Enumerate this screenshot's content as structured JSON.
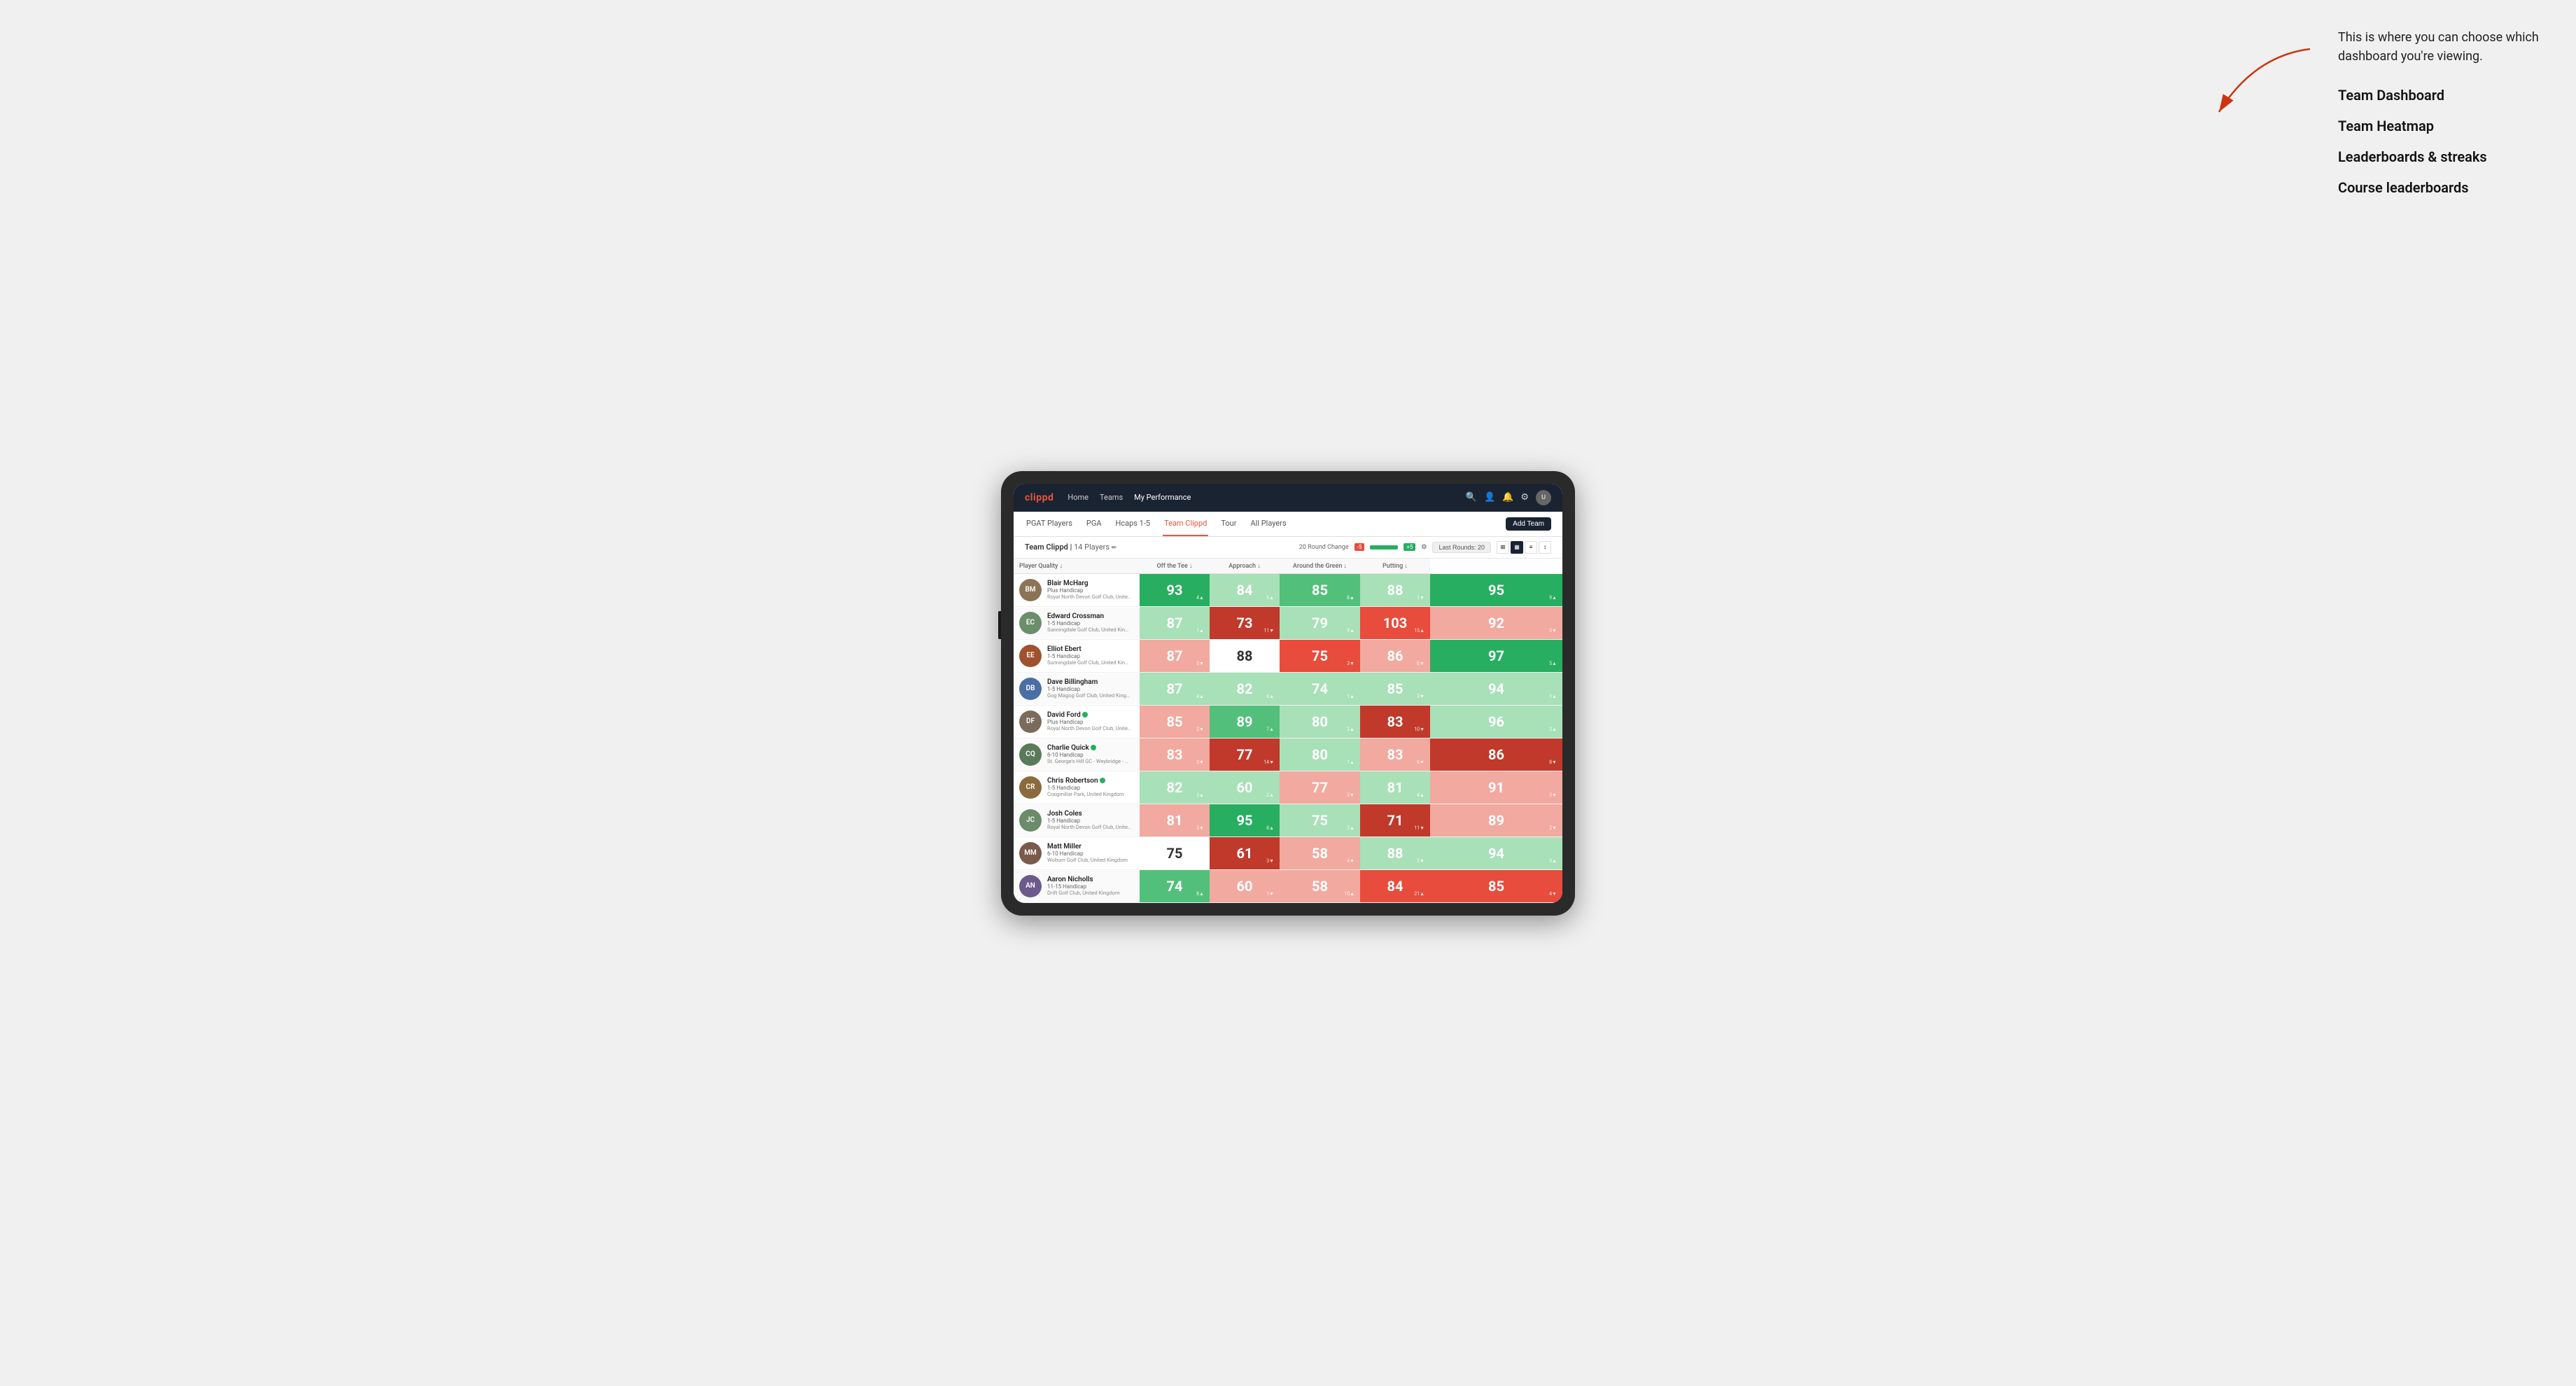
{
  "annotation": {
    "intro_text": "This is where you can choose which dashboard you're viewing.",
    "items": [
      "Team Dashboard",
      "Team Heatmap",
      "Leaderboards & streaks",
      "Course leaderboards"
    ]
  },
  "nav": {
    "logo": "clippd",
    "items": [
      {
        "label": "Home",
        "active": false
      },
      {
        "label": "Teams",
        "active": false
      },
      {
        "label": "My Performance",
        "active": true
      }
    ],
    "icons": [
      "search",
      "person",
      "bell",
      "settings",
      "user-avatar"
    ]
  },
  "sub_nav": {
    "tabs": [
      {
        "label": "PGAT Players",
        "active": false
      },
      {
        "label": "PGA",
        "active": false
      },
      {
        "label": "Hcaps 1-5",
        "active": false
      },
      {
        "label": "Team Clippd",
        "active": true
      },
      {
        "label": "Tour",
        "active": false
      },
      {
        "label": "All Players",
        "active": false
      }
    ],
    "add_team_label": "Add Team"
  },
  "team_header": {
    "title": "Team Clippd",
    "player_count": "14 Players",
    "round_change_label": "20 Round Change",
    "neg_value": "-5",
    "pos_value": "+5",
    "last_rounds_label": "Last Rounds:",
    "last_rounds_value": "20",
    "view_types": [
      "grid-small",
      "grid-large",
      "heatmap",
      "settings"
    ]
  },
  "columns": [
    {
      "label": "Player Quality",
      "key": "player_quality",
      "has_arrow": true
    },
    {
      "label": "Off the Tee",
      "key": "off_tee",
      "has_arrow": true
    },
    {
      "label": "Approach",
      "key": "approach",
      "has_arrow": true
    },
    {
      "label": "Around the Green",
      "key": "around_green",
      "has_arrow": true
    },
    {
      "label": "Putting",
      "key": "putting",
      "has_arrow": true
    }
  ],
  "players": [
    {
      "name": "Blair McHarg",
      "handicap": "Plus Handicap",
      "club": "Royal North Devon Golf Club, United Kingdom",
      "avatar_color": "#8B7355",
      "initials": "BM",
      "verified": false,
      "scores": [
        {
          "value": "93",
          "change": "4▲",
          "change_dir": "up",
          "bg": "bg-green-dark"
        },
        {
          "value": "84",
          "change": "6▲",
          "change_dir": "up",
          "bg": "bg-green-light"
        },
        {
          "value": "85",
          "change": "8▲",
          "change_dir": "up",
          "bg": "bg-green-mid"
        },
        {
          "value": "88",
          "change": "1▼",
          "change_dir": "down",
          "bg": "bg-green-light"
        },
        {
          "value": "95",
          "change": "9▲",
          "change_dir": "up",
          "bg": "bg-green-dark"
        }
      ]
    },
    {
      "name": "Edward Crossman",
      "handicap": "1-5 Handicap",
      "club": "Sunningdale Golf Club, United Kingdom",
      "avatar_color": "#6B8E6B",
      "initials": "EC",
      "verified": false,
      "scores": [
        {
          "value": "87",
          "change": "1▲",
          "change_dir": "up",
          "bg": "bg-green-light"
        },
        {
          "value": "73",
          "change": "11▼",
          "change_dir": "down",
          "bg": "bg-red-dark"
        },
        {
          "value": "79",
          "change": "9▲",
          "change_dir": "up",
          "bg": "bg-green-light"
        },
        {
          "value": "103",
          "change": "15▲",
          "change_dir": "up",
          "bg": "bg-red-mid"
        },
        {
          "value": "92",
          "change": "3▼",
          "change_dir": "down",
          "bg": "bg-red-light"
        }
      ]
    },
    {
      "name": "Elliot Ebert",
      "handicap": "1-5 Handicap",
      "club": "Sunningdale Golf Club, United Kingdom",
      "avatar_color": "#A0522D",
      "initials": "EE",
      "verified": false,
      "scores": [
        {
          "value": "87",
          "change": "3▼",
          "change_dir": "down",
          "bg": "bg-red-light"
        },
        {
          "value": "88",
          "change": "",
          "change_dir": "",
          "bg": "bg-white"
        },
        {
          "value": "75",
          "change": "3▼",
          "change_dir": "down",
          "bg": "bg-red-mid"
        },
        {
          "value": "86",
          "change": "6▼",
          "change_dir": "down",
          "bg": "bg-red-light"
        },
        {
          "value": "97",
          "change": "5▲",
          "change_dir": "up",
          "bg": "bg-green-dark"
        }
      ]
    },
    {
      "name": "Dave Billingham",
      "handicap": "1-5 Handicap",
      "club": "Gog Magog Golf Club, United Kingdom",
      "avatar_color": "#4A6FA5",
      "initials": "DB",
      "verified": false,
      "scores": [
        {
          "value": "87",
          "change": "4▲",
          "change_dir": "up",
          "bg": "bg-green-light"
        },
        {
          "value": "82",
          "change": "4▲",
          "change_dir": "up",
          "bg": "bg-green-light"
        },
        {
          "value": "74",
          "change": "1▲",
          "change_dir": "up",
          "bg": "bg-green-light"
        },
        {
          "value": "85",
          "change": "3▼",
          "change_dir": "down",
          "bg": "bg-green-light"
        },
        {
          "value": "94",
          "change": "1▲",
          "change_dir": "up",
          "bg": "bg-green-light"
        }
      ]
    },
    {
      "name": "David Ford",
      "handicap": "Plus Handicap",
      "club": "Royal North Devon Golf Club, United Kingdom",
      "avatar_color": "#7B6B5A",
      "initials": "DF",
      "verified": true,
      "scores": [
        {
          "value": "85",
          "change": "3▼",
          "change_dir": "down",
          "bg": "bg-red-light"
        },
        {
          "value": "89",
          "change": "7▲",
          "change_dir": "up",
          "bg": "bg-green-mid"
        },
        {
          "value": "80",
          "change": "3▲",
          "change_dir": "up",
          "bg": "bg-green-light"
        },
        {
          "value": "83",
          "change": "10▼",
          "change_dir": "down",
          "bg": "bg-red-dark"
        },
        {
          "value": "96",
          "change": "3▲",
          "change_dir": "up",
          "bg": "bg-green-light"
        }
      ]
    },
    {
      "name": "Charlie Quick",
      "handicap": "6-10 Handicap",
      "club": "St. George's Hill GC - Weybridge - Surrey, Uni...",
      "avatar_color": "#5A7A5A",
      "initials": "CQ",
      "verified": true,
      "scores": [
        {
          "value": "83",
          "change": "3▼",
          "change_dir": "down",
          "bg": "bg-red-light"
        },
        {
          "value": "77",
          "change": "14▼",
          "change_dir": "down",
          "bg": "bg-red-dark"
        },
        {
          "value": "80",
          "change": "1▲",
          "change_dir": "up",
          "bg": "bg-green-light"
        },
        {
          "value": "83",
          "change": "6▼",
          "change_dir": "down",
          "bg": "bg-red-light"
        },
        {
          "value": "86",
          "change": "8▼",
          "change_dir": "down",
          "bg": "bg-red-dark"
        }
      ]
    },
    {
      "name": "Chris Robertson",
      "handicap": "1-5 Handicap",
      "club": "Craigmillar Park, United Kingdom",
      "avatar_color": "#8B6B3D",
      "initials": "CR",
      "verified": true,
      "scores": [
        {
          "value": "82",
          "change": "3▲",
          "change_dir": "up",
          "bg": "bg-green-light"
        },
        {
          "value": "60",
          "change": "2▲",
          "change_dir": "up",
          "bg": "bg-green-light"
        },
        {
          "value": "77",
          "change": "3▼",
          "change_dir": "down",
          "bg": "bg-red-light"
        },
        {
          "value": "81",
          "change": "4▲",
          "change_dir": "up",
          "bg": "bg-green-light"
        },
        {
          "value": "91",
          "change": "3▼",
          "change_dir": "down",
          "bg": "bg-red-light"
        }
      ]
    },
    {
      "name": "Josh Coles",
      "handicap": "1-5 Handicap",
      "club": "Royal North Devon Golf Club, United Kingdom",
      "avatar_color": "#6B8B6B",
      "initials": "JC",
      "verified": false,
      "scores": [
        {
          "value": "81",
          "change": "3▼",
          "change_dir": "down",
          "bg": "bg-red-light"
        },
        {
          "value": "95",
          "change": "8▲",
          "change_dir": "up",
          "bg": "bg-green-dark"
        },
        {
          "value": "75",
          "change": "2▲",
          "change_dir": "up",
          "bg": "bg-green-light"
        },
        {
          "value": "71",
          "change": "11▼",
          "change_dir": "down",
          "bg": "bg-red-dark"
        },
        {
          "value": "89",
          "change": "2▼",
          "change_dir": "down",
          "bg": "bg-red-light"
        }
      ]
    },
    {
      "name": "Matt Miller",
      "handicap": "6-10 Handicap",
      "club": "Woburn Golf Club, United Kingdom",
      "avatar_color": "#7A5A4A",
      "initials": "MM",
      "verified": false,
      "scores": [
        {
          "value": "75",
          "change": "",
          "change_dir": "",
          "bg": "bg-white"
        },
        {
          "value": "61",
          "change": "3▼",
          "change_dir": "down",
          "bg": "bg-red-dark"
        },
        {
          "value": "58",
          "change": "4▼",
          "change_dir": "down",
          "bg": "bg-red-light"
        },
        {
          "value": "88",
          "change": "2▼",
          "change_dir": "down",
          "bg": "bg-green-light"
        },
        {
          "value": "94",
          "change": "3▲",
          "change_dir": "up",
          "bg": "bg-green-light"
        }
      ]
    },
    {
      "name": "Aaron Nicholls",
      "handicap": "11-15 Handicap",
      "club": "Drift Golf Club, United Kingdom",
      "avatar_color": "#6B5A8B",
      "initials": "AN",
      "verified": false,
      "scores": [
        {
          "value": "74",
          "change": "8▲",
          "change_dir": "up",
          "bg": "bg-green-mid"
        },
        {
          "value": "60",
          "change": "1▼",
          "change_dir": "down",
          "bg": "bg-red-light"
        },
        {
          "value": "58",
          "change": "10▲",
          "change_dir": "up",
          "bg": "bg-red-light"
        },
        {
          "value": "84",
          "change": "21▲",
          "change_dir": "up",
          "bg": "bg-red-mid"
        },
        {
          "value": "85",
          "change": "4▼",
          "change_dir": "down",
          "bg": "bg-red-mid"
        }
      ]
    }
  ]
}
